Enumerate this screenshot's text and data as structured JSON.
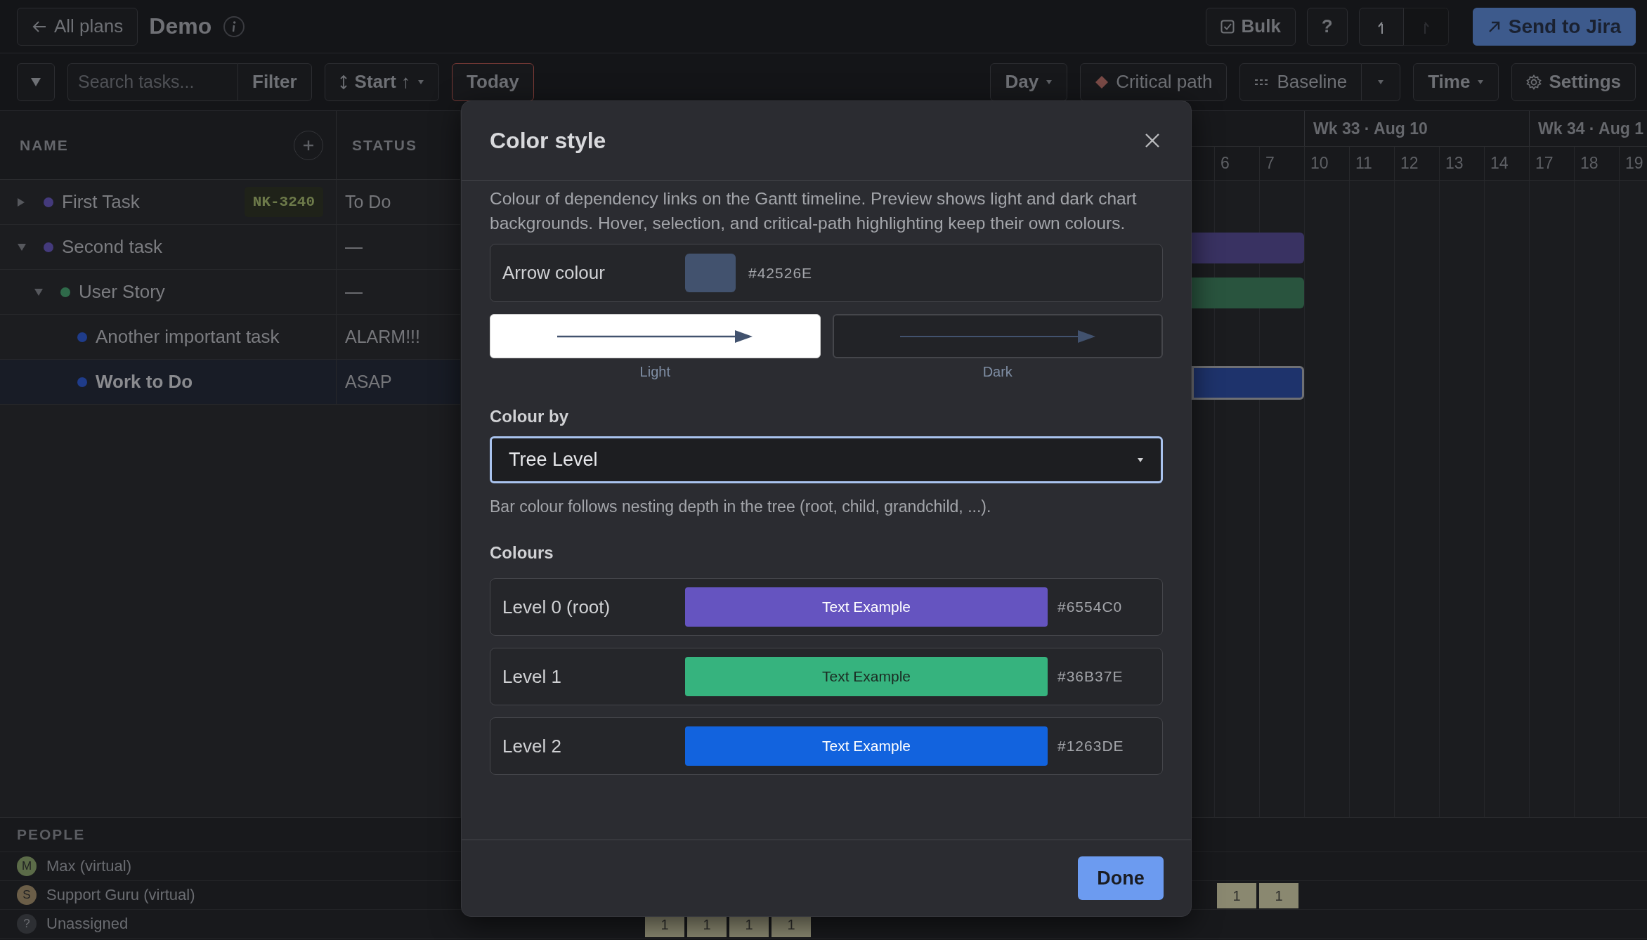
{
  "topbar": {
    "back_button": "All plans",
    "title": "Demo",
    "bulk_button": "Bulk",
    "help_button": "?",
    "history": [
      {
        "kind": "undo",
        "disabled": false
      },
      {
        "kind": "redo",
        "disabled": true
      }
    ],
    "send_button": "Send to Jira"
  },
  "toolbar": {
    "search": {
      "placeholder": "Search tasks..."
    },
    "filter_button": "Filter",
    "sort_button": "Start ↑",
    "today_button": "Today",
    "scale_select": "Day",
    "critical_path_button": "Critical path",
    "baseline_button": "Baseline",
    "time_select": "Time",
    "settings_button": "Settings"
  },
  "table": {
    "columns": [
      "NAME",
      "STATUS"
    ],
    "rows": [
      {
        "name": "First Task",
        "color": "#443a7c",
        "expanded": false,
        "key": "NK-3240",
        "status": "To Do",
        "selected": false,
        "bar": false
      },
      {
        "name": "Second task",
        "color": "#443a7c",
        "expanded": true,
        "status": "—",
        "selected": false,
        "bar": true,
        "children": [
          {
            "name": "User Story",
            "color": "#2f6a4a",
            "expanded": true,
            "status": "—",
            "selected": false,
            "bar": true,
            "children": [
              {
                "name": "Another important task",
                "color": "#1f3c8a",
                "status": "ALARM!!!",
                "selected": false,
                "bar": false
              },
              {
                "name": "Work to Do",
                "color": "#1f3c8a",
                "status": "ASAP",
                "selected": true,
                "bar": true
              }
            ]
          }
        ]
      }
    ]
  },
  "timeline": {
    "weeks": [
      "Wk 33 · Aug 10",
      "Wk 34 · Aug 1"
    ],
    "days": [
      "6",
      "7",
      "10",
      "11",
      "12",
      "13",
      "14",
      "17",
      "18",
      "19"
    ]
  },
  "people": {
    "title": "PEOPLE",
    "rows": [
      {
        "initial": "M",
        "name": "Max (virtual)",
        "color": "#5b6b48",
        "loads": []
      },
      {
        "initial": "S",
        "name": "Support Guru (virtual)",
        "color": "#6b5e48",
        "loads": [
          "1",
          "1"
        ]
      },
      {
        "initial": "?",
        "name": "Unassigned",
        "color": "#2d2f33",
        "loads": [
          "1",
          "1",
          "1",
          "1"
        ]
      }
    ]
  },
  "dialog": {
    "title": "Color style",
    "description": "Colour of dependency links on the Gantt timeline. Preview shows light and dark chart backgrounds. Hover, selection, and critical-path highlighting keep their own colours.",
    "arrow": {
      "label": "Arrow colour",
      "value": "#42526E"
    },
    "previews": [
      {
        "kind": "light",
        "label": "Light"
      },
      {
        "kind": "dark",
        "label": "Dark"
      }
    ],
    "colour_by": {
      "label": "Colour by",
      "value": "Tree Level",
      "hint": "Bar colour follows nesting depth in the tree (root, child, grandchild, ...)."
    },
    "colours": {
      "title": "Colours",
      "levels": [
        {
          "label": "Level 0 (root)",
          "color": "#6554c0",
          "sample": "Text Example",
          "value": "#6554C0"
        },
        {
          "label": "Level 1",
          "color": "#36b37e",
          "sample": "Text Example",
          "value": "#36B37E"
        },
        {
          "label": "Level 2",
          "color": "#1263de",
          "sample": "Text Example",
          "value": "#1263DE"
        }
      ]
    },
    "done_button": "Done"
  }
}
